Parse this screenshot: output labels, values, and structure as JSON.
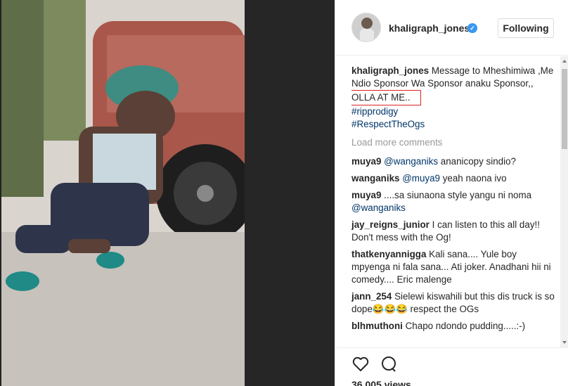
{
  "header": {
    "username": "khaligraph_jones",
    "verified_label": "✓",
    "follow_button": "Following"
  },
  "caption": {
    "username": "khaligraph_jones",
    "text": "Message to Mheshimiwa ,Me Ndio Sponsor Wa Sponsor anaku Sponsor,,",
    "highlighted_line": "OLLA AT ME..",
    "hashtags": [
      "#ripprodigy",
      "#RespectTheOgs"
    ]
  },
  "load_more": "Load more comments",
  "comments": [
    {
      "user": "muya9",
      "mention": "@wanganiks",
      "text": " ananicopy sindio?"
    },
    {
      "user": "wanganiks",
      "mention": "@muya9",
      "text": " yeah naona ivo"
    },
    {
      "user": "muya9",
      "mention": "",
      "text": "....sa siunaona style yangu ni noma",
      "trailing_mention": "@wanganiks"
    },
    {
      "user": "jay_reigns_junior",
      "mention": "",
      "text": "I can listen to this all day!! Don't mess with the Og!"
    },
    {
      "user": "thatkenyannigga",
      "mention": "",
      "text": "Kali sana.... Yule boy mpyenga ni fala sana... Ati joker. Anadhani hii ni comedy.... Eric malenge"
    },
    {
      "user": "jann_254",
      "mention": "",
      "text": "Sielewi kiswahili but this dis truck is so dope😂😂😂 respect the OGs"
    },
    {
      "user": "blhmuthoni",
      "mention": "",
      "text": "Chapo ndondo pudding.....:-)"
    }
  ],
  "footer": {
    "views": "36,005 views",
    "like_icon": "heart-icon",
    "comment_icon": "comment-icon"
  },
  "colors": {
    "link": "#003569",
    "verified": "#3897f0",
    "highlight_border": "#dd2222"
  }
}
